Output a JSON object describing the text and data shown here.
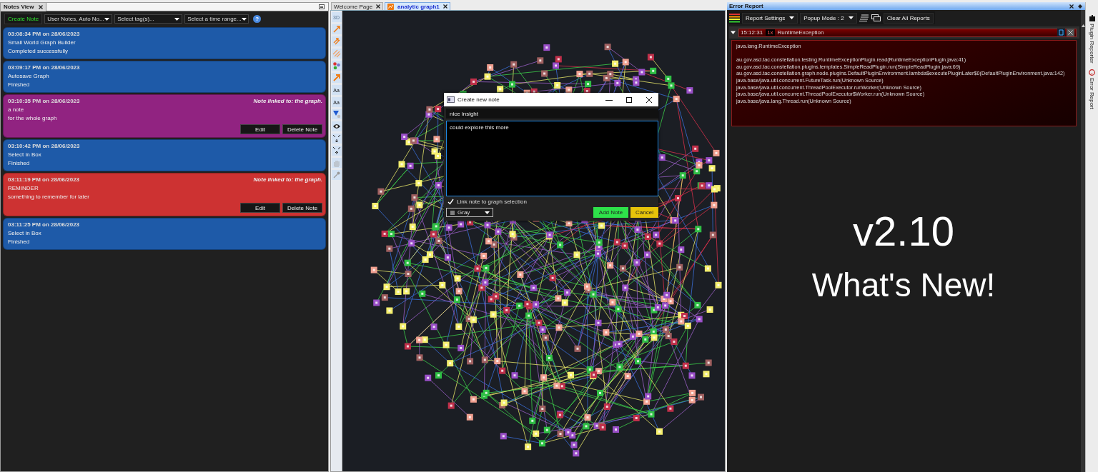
{
  "notes_view": {
    "title": "Notes View",
    "create_button": "Create Note",
    "filters": [
      {
        "value": "User Notes, Auto No..."
      },
      {
        "value": "Select tag(s)..."
      },
      {
        "value": "Select a time range..."
      }
    ],
    "help_button": "?",
    "notes": [
      {
        "timestamp": "03:08:34 PM on 28/06/2023",
        "title": "Small World Graph Builder",
        "body": "Completed successfully",
        "color": "#1e5aa8"
      },
      {
        "timestamp": "03:09:17 PM on 28/06/2023",
        "title": "Autosave Graph",
        "body": "Finished",
        "color": "#1e5aa8"
      },
      {
        "timestamp": "03:10:35 PM on 28/06/2023",
        "title": "a note",
        "body": "for the whole graph",
        "color": "#912381",
        "linked": "Note linked to: the graph.",
        "buttons": [
          "Edit",
          "Delete Note"
        ]
      },
      {
        "timestamp": "03:10:42 PM on 28/06/2023",
        "title": "Select in Box",
        "body": "Finished",
        "color": "#1e5aa8"
      },
      {
        "timestamp": "03:11:19 PM on 28/06/2023",
        "title": "REMINDER",
        "body": "something to remember for later",
        "color": "#cd3232",
        "linked": "Note linked to: the graph.",
        "buttons": [
          "Edit",
          "Delete Note"
        ]
      },
      {
        "timestamp": "03:11:25 PM on 28/06/2023",
        "title": "Select in Box",
        "body": "Finished",
        "color": "#1e5aa8"
      }
    ]
  },
  "tabs": [
    {
      "label": "Welcome Page",
      "selected": false
    },
    {
      "label": "analytic graph1",
      "selected": true
    }
  ],
  "graph_toolbar": {
    "toggle_3d": {
      "label": "3D",
      "disabled": true
    },
    "label_buttons": [
      "Aa",
      "Aa"
    ]
  },
  "note_dialog": {
    "title": "Create new note",
    "title_field": "nice insight",
    "content_field": "could explore this more",
    "link_checkbox": {
      "label": "Link note to graph selection",
      "checked": true
    },
    "color_dropdown": {
      "value": "Gray",
      "color": "#808080"
    },
    "buttons": [
      {
        "label": "Add Note",
        "kind": "add"
      },
      {
        "label": "Cancel",
        "kind": "cancel"
      }
    ]
  },
  "error_report": {
    "title": "Error Report",
    "toolbar": [
      {
        "label": "Report Settings",
        "kind": "dropdown"
      },
      {
        "label": "Popup Mode : 2",
        "kind": "dropdown"
      },
      {
        "label": "Clear All Reports",
        "kind": "button"
      }
    ],
    "report": {
      "time": "15:12:31",
      "count": "1x",
      "name": "RuntimeException",
      "expanded": true,
      "exception": "java.lang.RuntimeException",
      "stack": [
        "au.gov.asd.tac.constellation.testing.RuntimeExceptionPlugin.read(RuntimeExceptionPlugin.java:41)",
        "au.gov.asd.tac.constellation.plugins.templates.SimpleReadPlugin.run(SimpleReadPlugin.java:69)",
        "au.gov.asd.tac.constellation.graph.node.plugins.DefaultPluginEnvironment.lambda$executePluginLater$0(DefaultPluginEnvironment.java:142)",
        "java.base/java.util.concurrent.FutureTask.run(Unknown Source)",
        "java.base/java.util.concurrent.ThreadPoolExecutor.runWorker(Unknown Source)",
        "java.base/java.util.concurrent.ThreadPoolExecutor$Worker.run(Unknown Source)",
        "java.base/java.lang.Thread.run(Unknown Source)"
      ]
    },
    "whats_new": {
      "version": "v2.10",
      "headline": "What's New!"
    }
  },
  "side_tabs": [
    "Plugin Reporter",
    "Error Report"
  ]
}
